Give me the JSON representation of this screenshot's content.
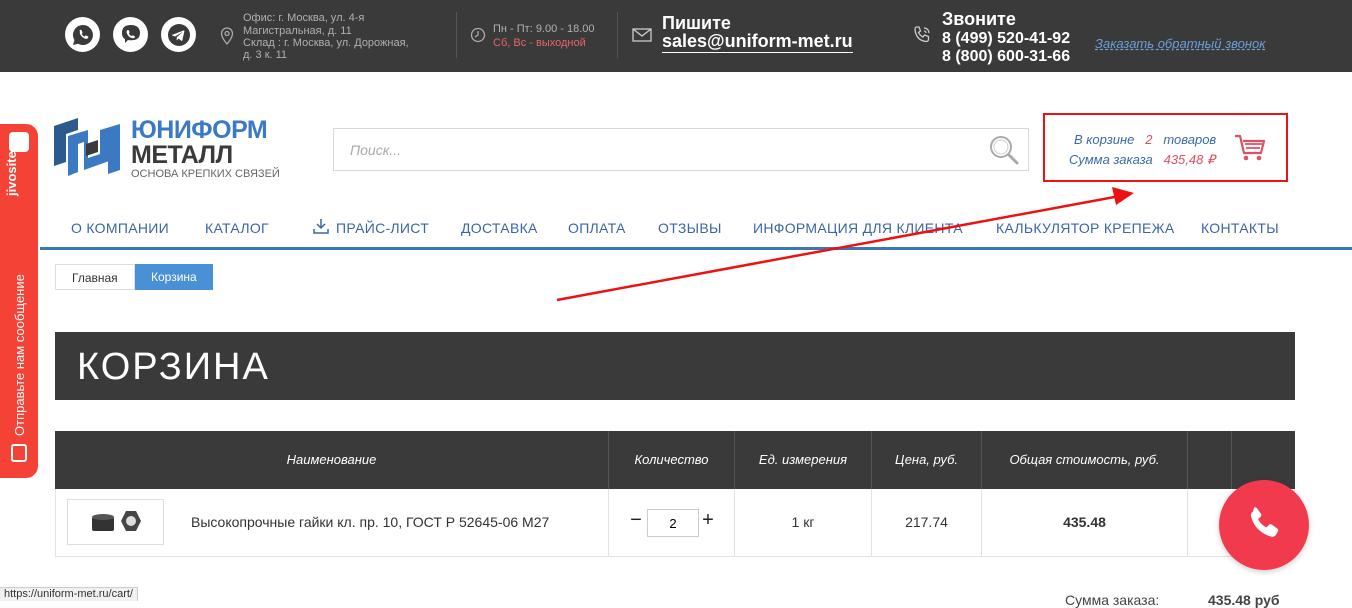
{
  "topbar": {
    "social": [
      "whatsapp-icon",
      "viber-icon",
      "telegram-icon"
    ],
    "address_line1": "Офис: г. Москва, ул. 4-я",
    "address_line2": "Магистральная, д. 11",
    "address_line3": "Склад : г. Москва, ул. Дорожная,",
    "address_line4": "д. 3 к. 11",
    "hours_line1": "Пн - Пт: 9.00 - 18.00",
    "hours_line2": "Сб, Вс - выходной",
    "write_label": "Пишите",
    "email": "sales@uniform-met.ru",
    "call_label": "Звоните",
    "phone1": "8 (499) 520-41-92",
    "phone2": "8 (800) 600-31-66",
    "callback_link": "Заказать обратный звонок"
  },
  "logo": {
    "line1": "ЮНИФОРМ",
    "line2": "МЕТАЛЛ",
    "tagline": "ОСНОВА КРЕПКИХ СВЯЗЕЙ"
  },
  "search": {
    "placeholder": "Поиск..."
  },
  "cart": {
    "in_cart_label": "В корзине",
    "count": "2",
    "items_word": "товаров",
    "sum_label": "Сумма заказа",
    "sum_value": "435,48 ₽"
  },
  "nav": {
    "items": [
      "О КОМПАНИИ",
      "КАТАЛОГ",
      "ПРАЙС-ЛИСТ",
      "ДОСТАВКА",
      "ОПЛАТА",
      "ОТЗЫВЫ",
      "ИНФОРМАЦИЯ ДЛЯ КЛИЕНТА",
      "КАЛЬКУЛЯТОР КРЕПЕЖА",
      "КОНТАКТЫ"
    ]
  },
  "breadcrumb": {
    "home": "Главная",
    "current": "Корзина"
  },
  "page": {
    "title": "КОРЗИНА"
  },
  "table": {
    "headers": [
      "Наименование",
      "Количество",
      "Ед. измерения",
      "Цена, руб.",
      "Общая стоимость, руб."
    ],
    "rows": [
      {
        "name": "Высокопрочные гайки кл. пр. 10, ГОСТ Р 52645-06 М27",
        "qty": "2",
        "unit": "1 кг",
        "price": "217.74",
        "total": "435.48"
      }
    ]
  },
  "summary": {
    "label": "Сумма заказа:",
    "value": "435.48 руб"
  },
  "jivo": {
    "brand": "jivosite",
    "message": "Отправьте нам сообщение"
  },
  "status_url": "https://uniform-met.ru/cart/",
  "colors": {
    "accent": "#3a77b8",
    "dark": "#3a3a3a",
    "highlight": "#ee1111",
    "call": "#f23a4e"
  }
}
